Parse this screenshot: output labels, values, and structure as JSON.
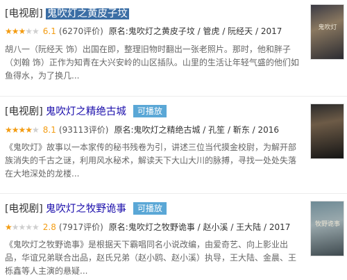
{
  "results": [
    {
      "tag": "[电视剧]",
      "title": "鬼吹灯之黄皮子坟",
      "playable": "",
      "stars": "★★★",
      "stars_off": "★★",
      "score": "6.1",
      "count": "(6270评价)",
      "orig": "原名:鬼吹灯之黄皮子坟 / 管虎 / 阮经天 / 2017",
      "desc": "胡八一（阮经天 饰）出国在即，整理旧物时翻出一张老照片。那时，他和胖子（刘翰 饰）正作为知青在大兴安岭的山区插队。山里的生活让年轻气盛的他们如鱼得水，为了换几...",
      "poster_text": "鬼吹灯",
      "poster_icon": "poster-image"
    },
    {
      "tag": "[电视剧]",
      "title": "鬼吹灯之精绝古城",
      "playable": "可播放",
      "stars": "★★★★",
      "stars_off": "★",
      "score": "8.1",
      "count": "(93113评价)",
      "orig": "原名:鬼吹灯之精绝古城 / 孔笙 / 靳东 / 2016",
      "desc": "《鬼吹灯》故事以一本家传的秘书残卷为引，讲述三位当代摸金校尉，为解开部族消失的千古之谜，利用风水秘术，解读天下大山大川的脉搏，寻找一处处失落在大地深处的龙楼...",
      "poster_text": "",
      "poster_icon": "poster-image"
    },
    {
      "tag": "[电视剧]",
      "title": "鬼吹灯之牧野诡事",
      "playable": "可播放",
      "stars": "★",
      "stars_off": "★★★★",
      "score": "2.8",
      "count": "(7917评价)",
      "orig": "原名:鬼吹灯之牧野诡事 / 赵小溪 / 王大陆 / 2017",
      "desc": "《鬼吹灯之牧野诡事》是根据天下霸唱同名小说改编，由爱奇艺、向上影业出品，华谊兄弟联合出品，赵氏兄弟（赵小鸥、赵小溪）执导，王大陆、金晨、王栎鑫等人主演的悬疑...",
      "poster_text": "牧野诡事",
      "poster_icon": "poster-image"
    }
  ]
}
